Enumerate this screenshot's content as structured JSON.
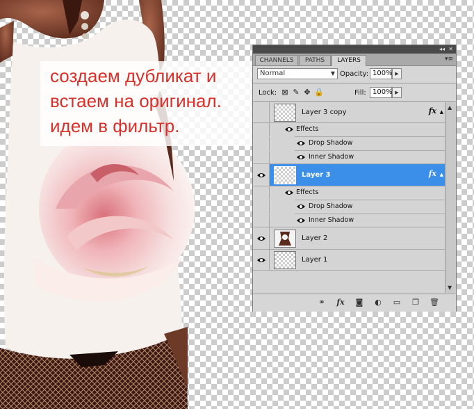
{
  "overlay": {
    "line1": "создаем дубликат и",
    "line2": "встаем на оригинал.",
    "line3": "идем в фильтр."
  },
  "panel": {
    "tabs": [
      "CHANNELS",
      "PATHS",
      "LAYERS"
    ],
    "active_tab": "LAYERS",
    "blend_mode": "Normal",
    "opacity_label": "Opacity:",
    "opacity_value": "100%",
    "lock_label": "Lock:",
    "fill_label": "Fill:",
    "fill_value": "100%",
    "fx_symbol": "fx",
    "layers": [
      {
        "name": "Layer 3 copy",
        "visible": false,
        "selected": false,
        "has_fx": true,
        "effects_label": "Effects",
        "effects": [
          "Drop Shadow",
          "Inner Shadow"
        ]
      },
      {
        "name": "Layer 3",
        "visible": true,
        "selected": true,
        "has_fx": true,
        "effects_label": "Effects",
        "effects": [
          "Drop Shadow",
          "Inner Shadow"
        ]
      },
      {
        "name": "Layer 2",
        "visible": true,
        "selected": false,
        "has_fx": false
      },
      {
        "name": "Layer 1",
        "visible": true,
        "selected": false,
        "has_fx": false
      }
    ],
    "bottom_icons": [
      "link-layers-icon",
      "fx-icon",
      "layer-mask-icon",
      "adjustment-layer-icon",
      "new-group-icon",
      "new-layer-icon",
      "trash-icon"
    ],
    "accent": "#3b8fe8"
  }
}
